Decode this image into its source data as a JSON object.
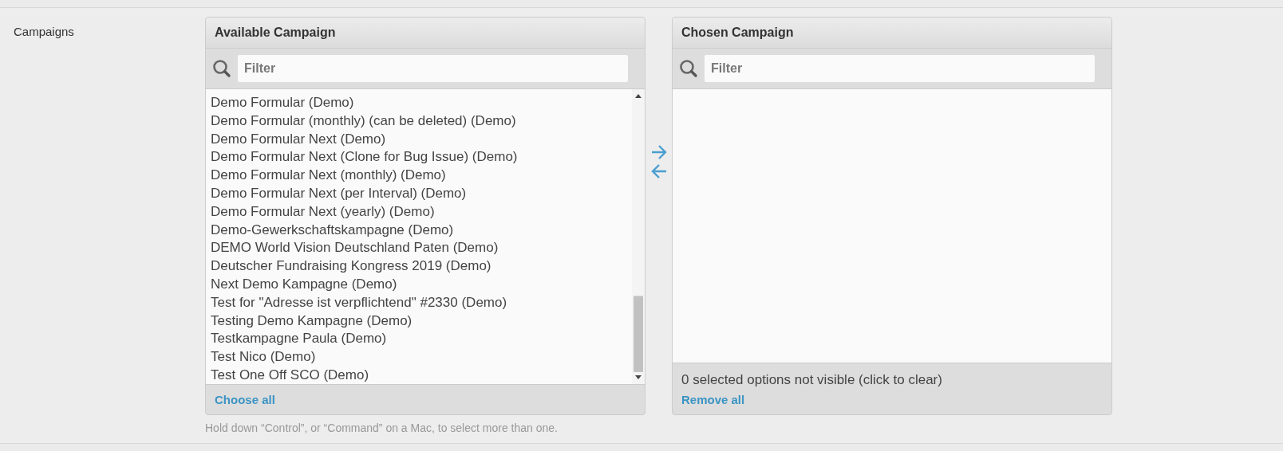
{
  "field_label": "Campaigns",
  "available": {
    "title": "Available Campaign",
    "filter": {
      "placeholder": "Filter"
    },
    "options": [
      "Demo Formular (Demo)",
      "Demo Formular (monthly) (can be deleted) (Demo)",
      "Demo Formular Next (Demo)",
      "Demo Formular Next (Clone for Bug Issue) (Demo)",
      "Demo Formular Next (monthly) (Demo)",
      "Demo Formular Next (per Interval) (Demo)",
      "Demo Formular Next (yearly) (Demo)",
      "Demo-Gewerkschaftskampagne (Demo)",
      "DEMO World Vision Deutschland Paten (Demo)",
      "Deutscher Fundraising Kongress 2019 (Demo)",
      "Next Demo Kampagne (Demo)",
      "Test for \"Adresse ist verpflichtend\" #2330 (Demo)",
      "Testing Demo Kampagne (Demo)",
      "Testkampagne Paula (Demo)",
      "Test Nico (Demo)",
      "Test One Off SCO (Demo)"
    ],
    "footer_link": "Choose all"
  },
  "chosen": {
    "title": "Chosen Campaign",
    "filter": {
      "placeholder": "Filter"
    },
    "hidden_note": "0 selected options not visible (click to clear)",
    "footer_link": "Remove all"
  },
  "help_text": "Hold down “Control”, or “Command” on a Mac, to select more than one."
}
